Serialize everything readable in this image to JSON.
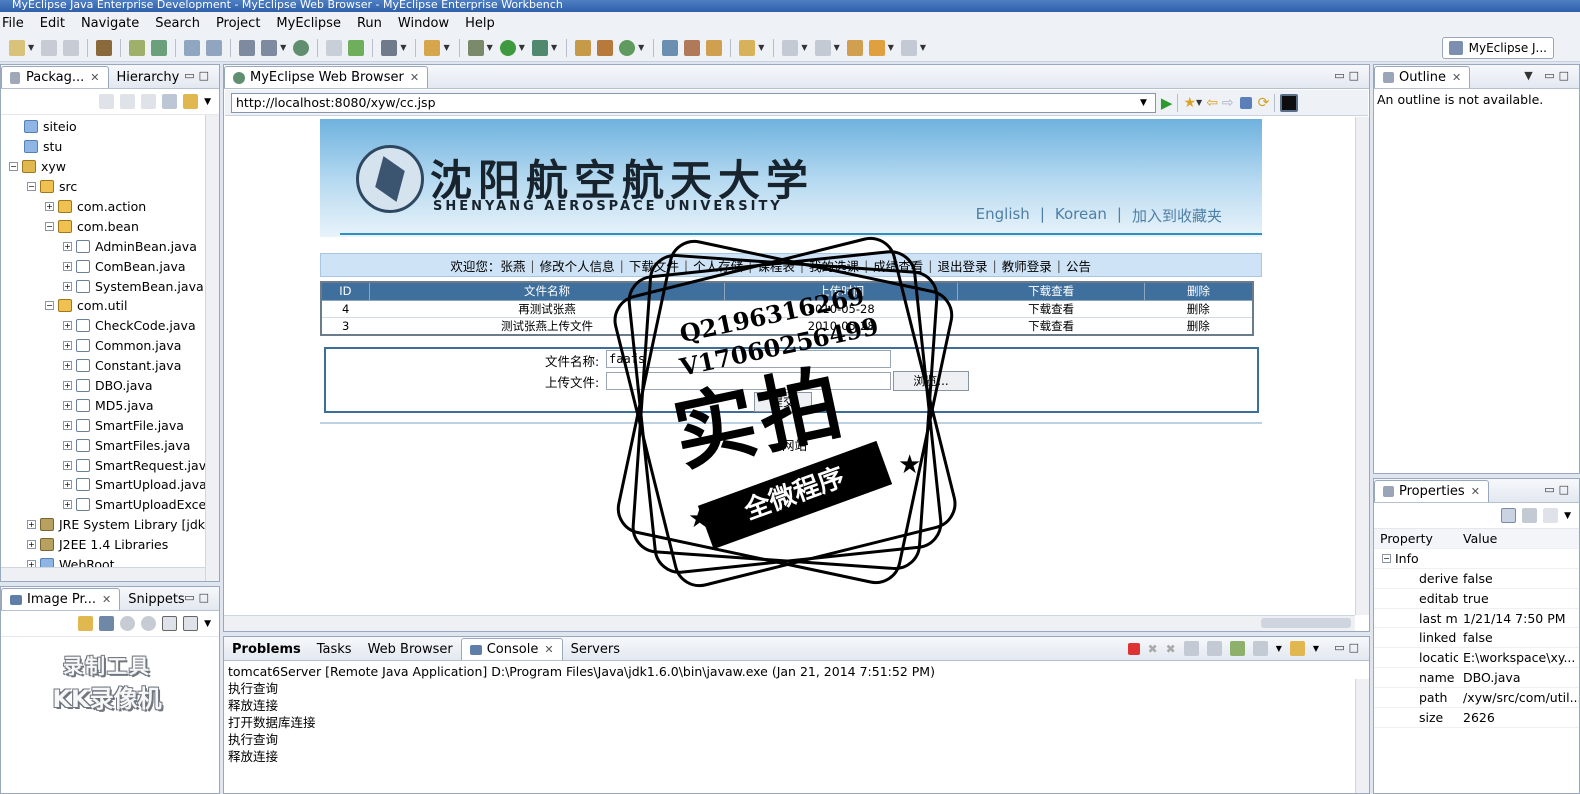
{
  "window": {
    "title": "MyEclipse Java Enterprise Development - MyEclipse Web Browser - MyEclipse Enterprise Workbench"
  },
  "menu": [
    "File",
    "Edit",
    "Navigate",
    "Search",
    "Project",
    "MyEclipse",
    "Run",
    "Window",
    "Help"
  ],
  "perspective": {
    "label": "MyEclipse J..."
  },
  "package_explorer": {
    "tabs": [
      "Packag...",
      "Hierarchy"
    ],
    "tree": [
      {
        "label": "siteio",
        "icon": "folder-icon"
      },
      {
        "label": "stu",
        "icon": "folder-icon"
      },
      {
        "label": "xyw",
        "icon": "project-icon"
      },
      {
        "label": "src",
        "icon": "source-folder-icon"
      },
      {
        "label": "com.action",
        "icon": "package-icon"
      },
      {
        "label": "com.bean",
        "icon": "package-icon"
      },
      {
        "label": "AdminBean.java",
        "icon": "java-file-icon"
      },
      {
        "label": "ComBean.java",
        "icon": "java-file-icon"
      },
      {
        "label": "SystemBean.java",
        "icon": "java-file-icon"
      },
      {
        "label": "com.util",
        "icon": "package-icon"
      },
      {
        "label": "CheckCode.java",
        "icon": "java-file-icon"
      },
      {
        "label": "Common.java",
        "icon": "java-file-icon"
      },
      {
        "label": "Constant.java",
        "icon": "java-file-icon"
      },
      {
        "label": "DBO.java",
        "icon": "java-file-icon"
      },
      {
        "label": "MD5.java",
        "icon": "java-file-icon"
      },
      {
        "label": "SmartFile.java",
        "icon": "java-file-icon"
      },
      {
        "label": "SmartFiles.java",
        "icon": "java-file-icon"
      },
      {
        "label": "SmartRequest.java",
        "icon": "java-file-icon"
      },
      {
        "label": "SmartUpload.java",
        "icon": "java-file-icon"
      },
      {
        "label": "SmartUploadExce",
        "icon": "java-file-icon"
      },
      {
        "label": "JRE System Library [jdk1",
        "icon": "library-icon"
      },
      {
        "label": "J2EE 1.4 Libraries",
        "icon": "library-icon"
      },
      {
        "label": "WebRoot",
        "icon": "folder-icon"
      }
    ]
  },
  "image_preview": {
    "tabs": [
      "Image Pr...",
      "Snippets"
    ]
  },
  "watermark_recorder": {
    "line1": "录制工具",
    "line2": "KK录像机"
  },
  "browser": {
    "tab": "MyEclipse Web Browser",
    "url": "http://localhost:8080/xyw/cc.jsp",
    "page": {
      "uni_cn": "沈阳航空航天大学",
      "uni_en": "SHENYANG AEROSPACE UNIVERSITY",
      "lang_links": [
        "English",
        "|",
        "Korean",
        "|",
        "加入到收藏夹"
      ],
      "nav": [
        "欢迎您：张燕",
        "修改个人信息",
        "下载文件",
        "个人存储",
        "课程表",
        "我的选课",
        "成绩查看",
        "退出登录",
        "教师登录",
        "公告"
      ],
      "table_headers": [
        "ID",
        "文件名称",
        "上传时间",
        "下载查看",
        "删除"
      ],
      "table_rows": [
        [
          "4",
          "再测试张燕",
          "2010-05-28",
          "下载查看",
          "删除"
        ],
        [
          "3",
          "测试张燕上传文件",
          "2010-05-28",
          "下载查看",
          "删除"
        ]
      ],
      "upload": {
        "name_label": "文件名称:",
        "name_value": "faafs",
        "file_label": "上传文件:",
        "browse_btn": "浏览...",
        "submit_btn": "提交"
      },
      "footer": "网站"
    }
  },
  "stamp_overlay": {
    "line1": "Q2196316269",
    "line2": "V17060256499",
    "big": "实拍",
    "band": "全微程序"
  },
  "outline": {
    "tab": "Outline",
    "message": "An outline is not available."
  },
  "console": {
    "tabs": [
      "Problems",
      "Tasks",
      "Web Browser",
      "Console",
      "Servers"
    ],
    "header": "tomcat6Server [Remote Java Application] D:\\Program Files\\Java\\jdk1.6.0\\bin\\javaw.exe (Jan 21, 2014 7:51:52 PM)",
    "lines": [
      "执行查询",
      "释放连接",
      "打开数据库连接",
      "执行查询",
      "释放连接"
    ]
  },
  "properties": {
    "tab": "Properties",
    "col_property": "Property",
    "col_value": "Value",
    "group": "Info",
    "rows": [
      [
        "derive",
        "false"
      ],
      [
        "editab",
        "true"
      ],
      [
        "last m",
        "1/21/14 7:50 PM"
      ],
      [
        "linked",
        "false"
      ],
      [
        "locatic",
        "E:\\workspace\\xy..."
      ],
      [
        "name",
        "DBO.java"
      ],
      [
        "path",
        "/xyw/src/com/util..."
      ],
      [
        "size",
        "2626"
      ]
    ]
  },
  "colors": {
    "accent": "#3f6f9c",
    "banner": "#6fb2df",
    "upload_border": "#3c6e98"
  }
}
